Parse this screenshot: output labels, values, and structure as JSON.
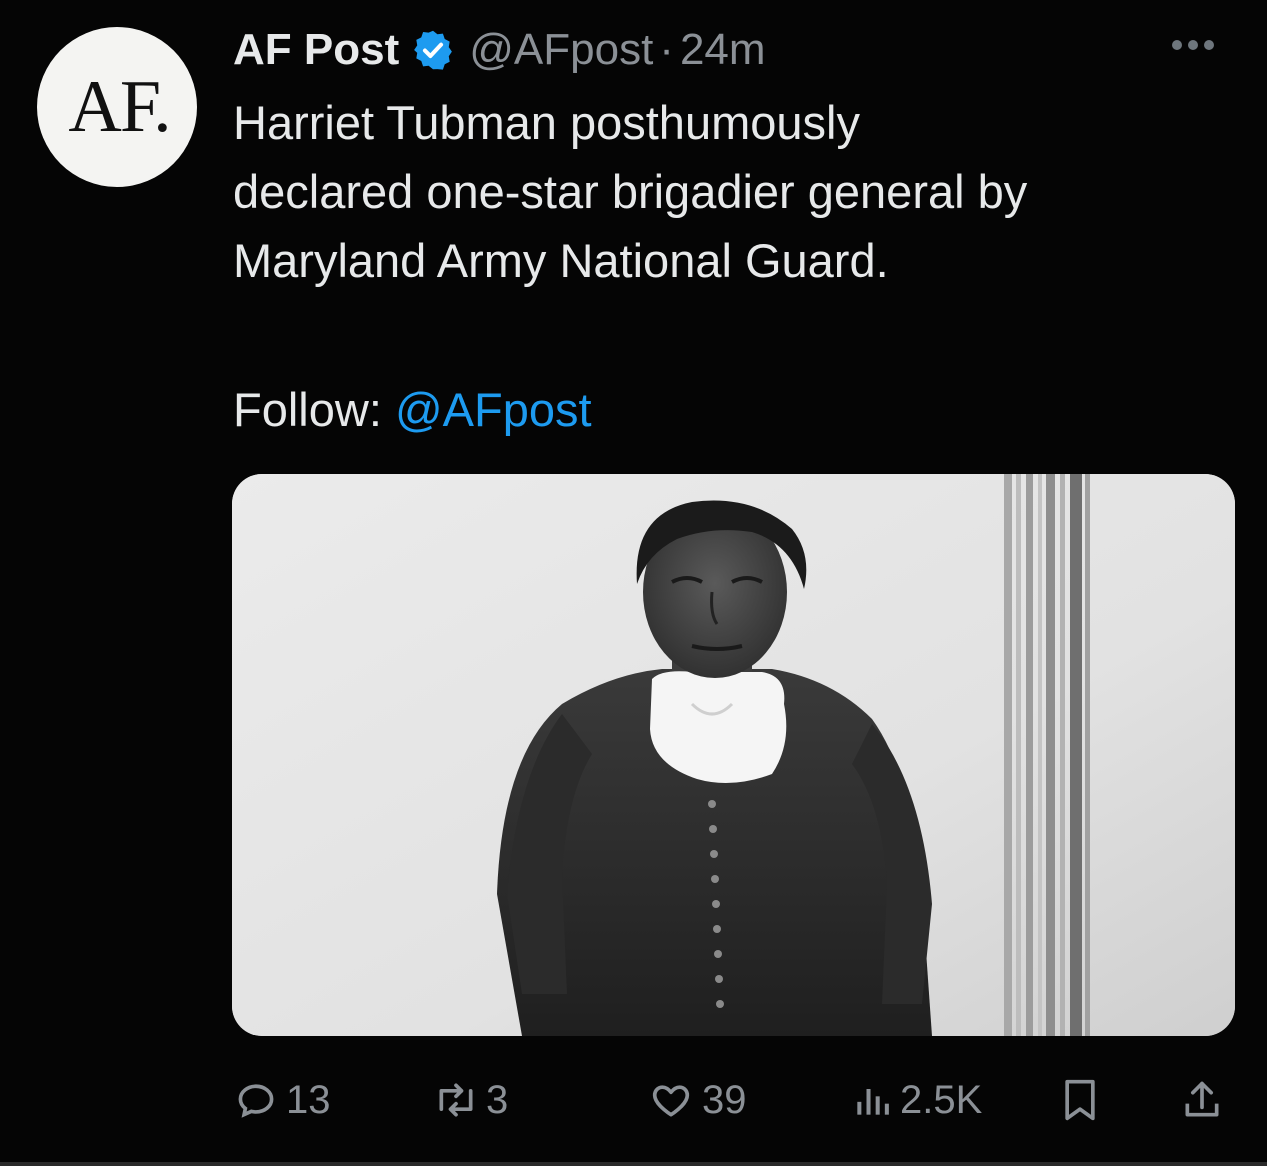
{
  "avatar": {
    "text": "AF."
  },
  "header": {
    "display_name": "AF Post",
    "handle": "@AFpost",
    "separator": "·",
    "time": "24m"
  },
  "tweet": {
    "lines": [
      "Harriet Tubman posthumously",
      "declared one-star brigadier general by",
      "Maryland Army National Guard."
    ],
    "follow_label": "Follow: ",
    "follow_mention": "@AFpost"
  },
  "actions": {
    "replies": "13",
    "reposts": "3",
    "likes": "39",
    "views": "2.5K"
  },
  "colors": {
    "background": "#050505",
    "text": "#e7e9ea",
    "muted": "#8b9096",
    "accent": "#1d9bf0"
  },
  "icons": {
    "verified": "verified-badge-icon",
    "more": "more-options-icon",
    "reply": "reply-icon",
    "repost": "repost-icon",
    "like": "heart-icon",
    "views": "analytics-icon",
    "bookmark": "bookmark-icon",
    "share": "share-icon"
  }
}
